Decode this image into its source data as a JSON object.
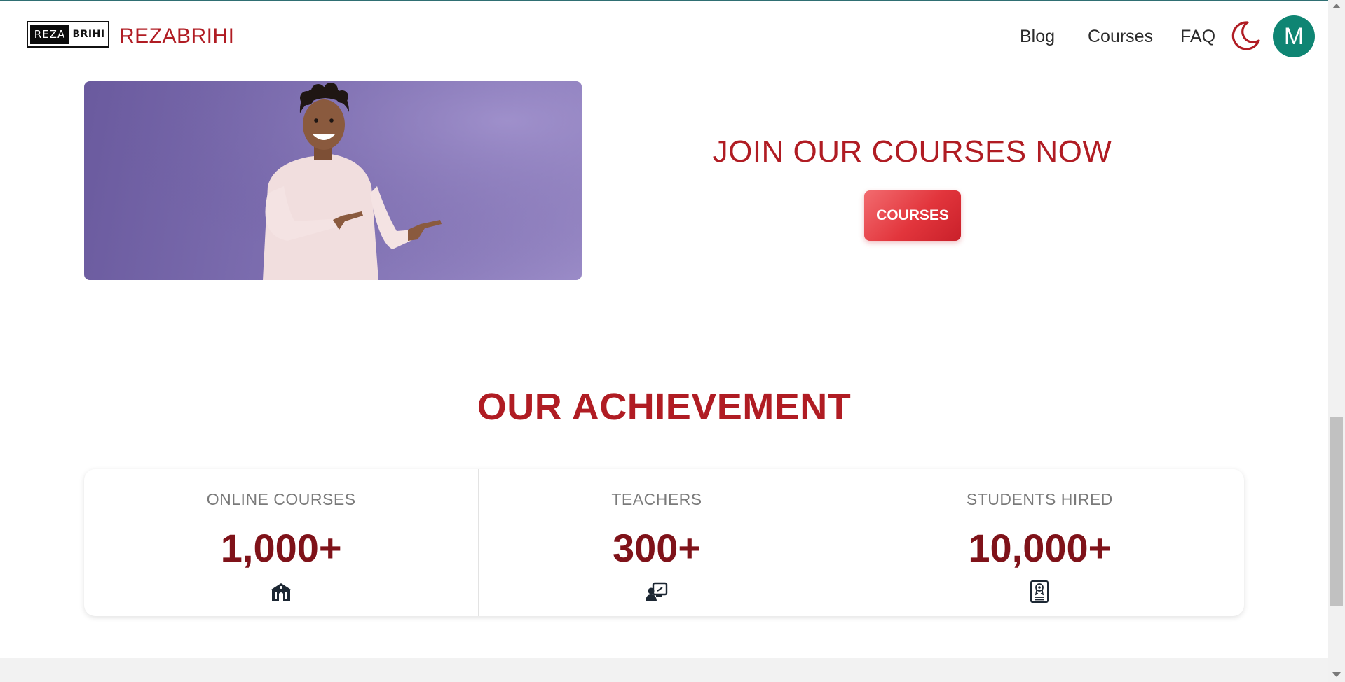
{
  "header": {
    "logo_left": "REZA",
    "logo_right": "BRIHI",
    "brand_name": "REZABRIHI",
    "nav": [
      {
        "label": "Blog"
      },
      {
        "label": "Courses"
      },
      {
        "label": "FAQ"
      }
    ],
    "avatar_initial": "M",
    "theme_icon": "moon-icon"
  },
  "hero": {
    "image": "person-pointing-image",
    "title": "JOIN OUR COURSES NOW",
    "button_label": "COURSES"
  },
  "achievement": {
    "title": "OUR ACHIEVEMENT",
    "stats": [
      {
        "label": "ONLINE COURSES",
        "value": "1,000+",
        "icon": "school-icon"
      },
      {
        "label": "TEACHERS",
        "value": "300+",
        "icon": "teacher-board-icon"
      },
      {
        "label": "STUDENTS HIRED",
        "value": "10,000+",
        "icon": "certificate-icon"
      }
    ]
  },
  "colors": {
    "brand_red": "#b01c23",
    "stat_value": "#7f1219",
    "avatar_bg": "#0f8573",
    "hero_bg": "#7e6fb1"
  }
}
